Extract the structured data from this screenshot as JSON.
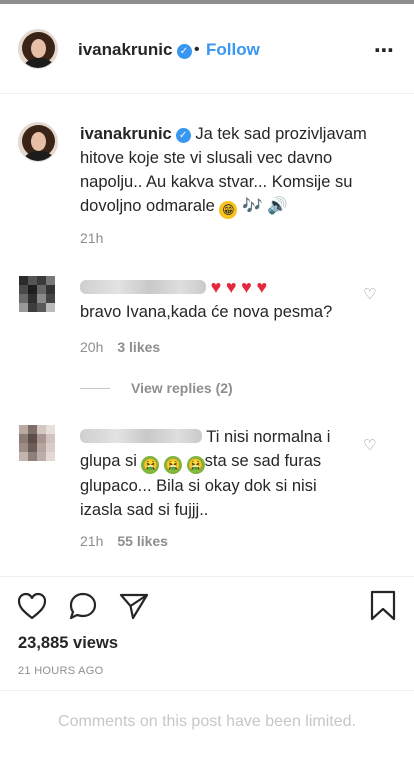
{
  "header": {
    "username": "ivanakrunic",
    "verified_mark": "✓",
    "dot": "•",
    "follow_label": "Follow",
    "more_icon": "⋯"
  },
  "caption": {
    "username": "ivanakrunic",
    "verified_mark": "✓",
    "text": "Ja tek sad prozivljavam hitove koje ste vi slusali vec davno napolju.. Au kakva stvar... Komsije su dovoljno odmarale",
    "emojis": [
      "grinning-face",
      "musical-notes",
      "speaker-high-volume"
    ],
    "time": "21h"
  },
  "comments": [
    {
      "emojis": [
        "red-heart",
        "red-heart",
        "red-heart",
        "red-heart"
      ],
      "text": "bravo Ivana,kada će nova pesma?",
      "time": "20h",
      "likes": "3 likes"
    },
    {
      "text_part1": "Ti nisi normalna i glupa si",
      "text_part2": "sta se sad furas glupaco... Bila si okay dok si nisi izasla sad si fujjj..",
      "emojis": [
        "nauseated-face",
        "nauseated-face",
        "nauseated-face"
      ],
      "time": "21h",
      "likes": "55 likes"
    }
  ],
  "view_replies": "View replies (2)",
  "actions": {
    "icons": [
      "heart-icon",
      "comment-icon",
      "share-icon",
      "bookmark-icon"
    ]
  },
  "views": "23,885 views",
  "posted_ago": "21 HOURS AGO",
  "limited_notice": "Comments on this post have been limited.",
  "colors": {
    "link_blue": "#3897f0",
    "muted_gray": "#8e8e8e",
    "text": "#262626",
    "divider": "#efefef"
  }
}
